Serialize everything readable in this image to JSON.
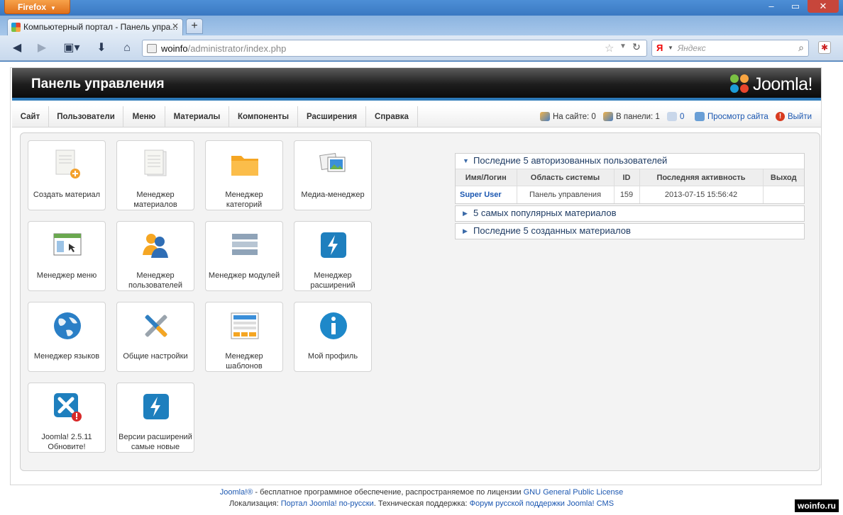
{
  "browser": {
    "app_button": "Firefox",
    "tab_title": "Компьютерный портал - Панель упра...",
    "url_host": "woinfo",
    "url_path": "/administrator/index.php",
    "search_engine": "Я",
    "search_placeholder": "Яндекс"
  },
  "header": {
    "title": "Панель управления",
    "logo_text": "Joomla!"
  },
  "menu": {
    "items": [
      "Сайт",
      "Пользователи",
      "Меню",
      "Материалы",
      "Компоненты",
      "Расширения",
      "Справка"
    ]
  },
  "status": {
    "on_site": "На сайте: 0",
    "in_panel": "В панели: 1",
    "messages": "0",
    "view_site": "Просмотр сайта",
    "logout": "Выйти"
  },
  "quick_icons": [
    {
      "label": "Создать материал",
      "icon": "add-article-icon"
    },
    {
      "label": "Менеджер материалов",
      "icon": "article-manager-icon"
    },
    {
      "label": "Менеджер категорий",
      "icon": "category-folder-icon"
    },
    {
      "label": "Медиа-менеджер",
      "icon": "media-manager-icon"
    },
    {
      "label": "Менеджер меню",
      "icon": "menu-manager-icon"
    },
    {
      "label": "Менеджер пользователей",
      "icon": "users-icon"
    },
    {
      "label": "Менеджер модулей",
      "icon": "modules-icon"
    },
    {
      "label": "Менеджер расширений",
      "icon": "extensions-bolt-icon"
    },
    {
      "label": "Менеджер языков",
      "icon": "globe-icon"
    },
    {
      "label": "Общие настройки",
      "icon": "tools-icon"
    },
    {
      "label": "Менеджер шаблонов",
      "icon": "template-icon"
    },
    {
      "label": "Мой профиль",
      "icon": "info-icon"
    },
    {
      "label": "Joomla! 2.5.11 Обновите!",
      "icon": "joomla-update-icon"
    },
    {
      "label": "Версии расширений самые новые",
      "icon": "extension-updates-icon"
    }
  ],
  "modules": {
    "logged": {
      "title": "Последние 5 авторизованных пользователей",
      "columns": [
        "Имя/Логин",
        "Область системы",
        "ID",
        "Последняя активность",
        "Выход"
      ],
      "rows": [
        [
          "Super User",
          "Панель управления",
          "159",
          "2013-07-15 15:56:42",
          ""
        ]
      ]
    },
    "popular": {
      "title": "5 самых популярных материалов"
    },
    "latest": {
      "title": "Последние 5 созданных материалов"
    }
  },
  "footer": {
    "line1_link": "Joomla!®",
    "line1_text": " - бесплатное программное обеспечение, распространяемое по лицензии ",
    "line1_license": "GNU General Public License",
    "line2_prefix": "Локализация: ",
    "line2_link1": "Портал Joomla! по-русски",
    "line2_mid": ". Техническая поддержка: ",
    "line2_link2": "Форум русской поддержки Joomla! CMS"
  },
  "watermark": "woinfo.ru",
  "colors": {
    "accent_blue": "#2d7ab9",
    "link": "#1b57b1",
    "header_dark": "#1d1d1d"
  }
}
